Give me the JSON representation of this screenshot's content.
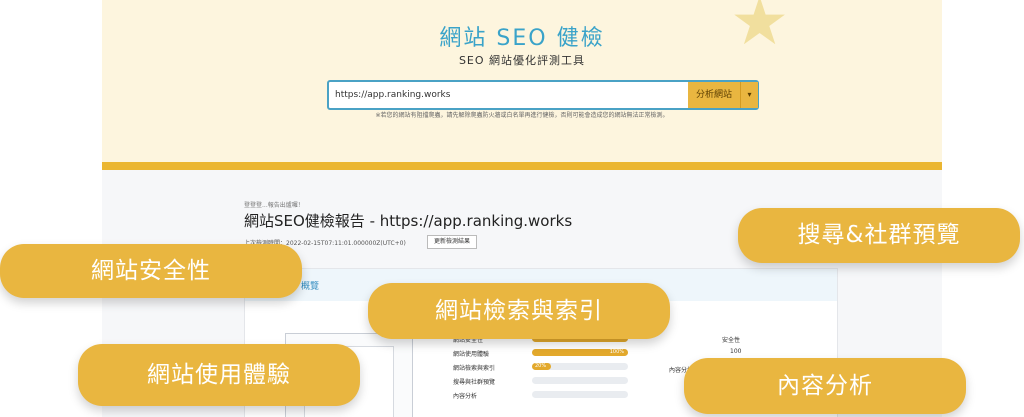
{
  "hero": {
    "title": "網站 SEO 健檢",
    "subtitle": "SEO 網站優化評測工具",
    "search_value": "https://app.ranking.works",
    "analyze_label": "分析網站",
    "dropdown_glyph": "▾",
    "notice": "※若您的網站有阻擋爬蟲，請先解除爬蟲防火牆或白名單再進行健檢，否則可能會造成您的網站無法正常檢測。"
  },
  "report": {
    "loading_text": "登登登...報告出爐囉！",
    "title": "網站SEO健檢報告 - https://app.ranking.works",
    "time_text": "上次檢測時間：2022-02-15T07:11:01.000000Z(UTC+0)",
    "refresh_label": "更新檢測結果",
    "overview_title": "概覽",
    "metrics": [
      {
        "label": "網站安全性",
        "percent": 100,
        "value_text": "100%"
      },
      {
        "label": "網站使用體驗",
        "percent": 100,
        "value_text": "100%"
      },
      {
        "label": "網站檢索與索引",
        "percent": 20,
        "value_text": "20%"
      },
      {
        "label": "搜尋與社群預覽",
        "percent": 0,
        "value_text": ""
      },
      {
        "label": "內容分析",
        "percent": 0,
        "value_text": ""
      }
    ],
    "side_label": "安全性",
    "side_value": "100",
    "content_label": "內容分析"
  },
  "callouts": {
    "search_social": "搜尋&社群預覽",
    "security": "網站安全性",
    "index": "網站檢索與索引",
    "ux": "網站使用體驗",
    "content": "內容分析"
  },
  "colors": {
    "accent": "#e9b640",
    "title_blue": "#3aa3c9",
    "hero_bg": "#fdf5de"
  }
}
